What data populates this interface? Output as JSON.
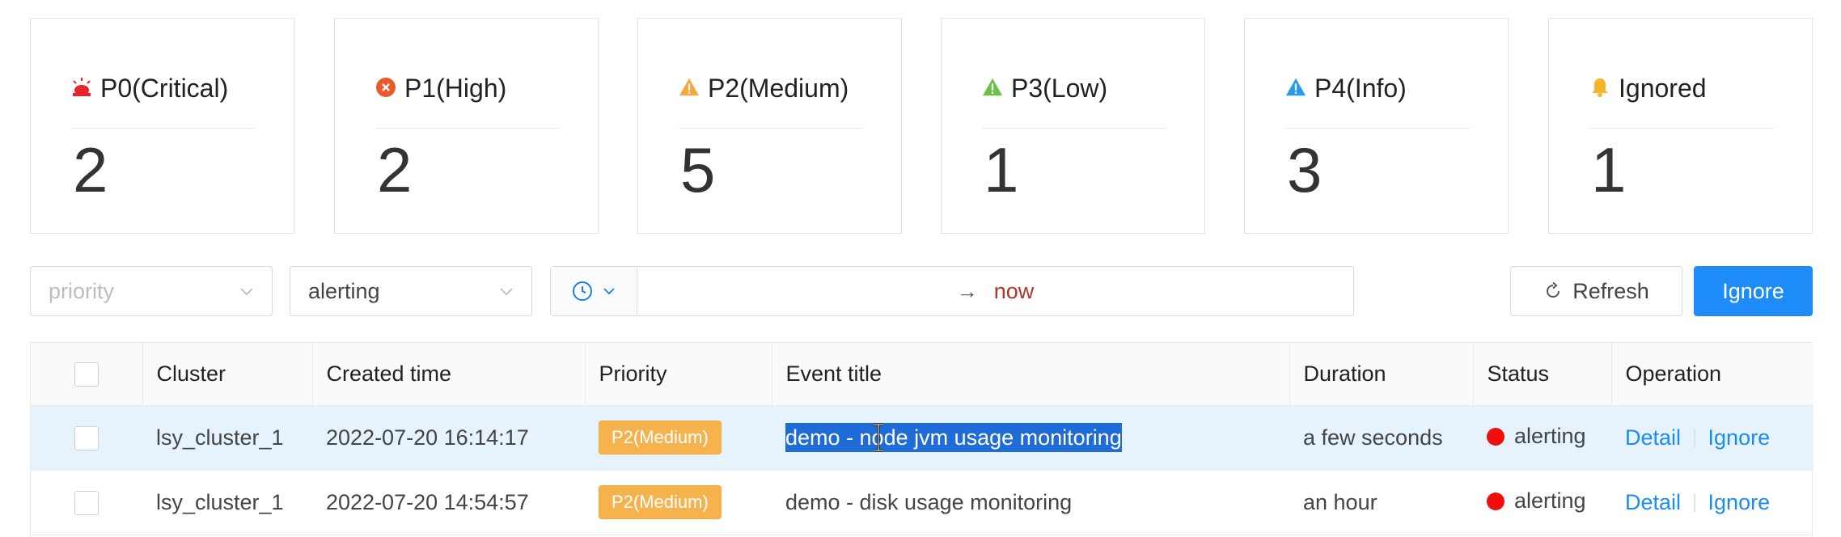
{
  "summary_cards": [
    {
      "label": "P0(Critical)",
      "count": "2",
      "icon": "siren-icon",
      "color": "#e8242b"
    },
    {
      "label": "P1(High)",
      "count": "2",
      "icon": "error-circle-icon",
      "color": "#ec5a2b"
    },
    {
      "label": "P2(Medium)",
      "count": "5",
      "icon": "warning-triangle-icon",
      "color": "#f5a742"
    },
    {
      "label": "P3(Low)",
      "count": "1",
      "icon": "warning-triangle-icon",
      "color": "#6fbf4b"
    },
    {
      "label": "P4(Info)",
      "count": "3",
      "icon": "warning-triangle-icon",
      "color": "#2a9be8"
    },
    {
      "label": "Ignored",
      "count": "1",
      "icon": "bell-icon",
      "color": "#f5b52a"
    }
  ],
  "filters": {
    "priority_placeholder": "priority",
    "status_value": "alerting",
    "time_end": "now"
  },
  "buttons": {
    "refresh": "Refresh",
    "ignore": "Ignore"
  },
  "table": {
    "headers": [
      "Cluster",
      "Created time",
      "Priority",
      "Event title",
      "Duration",
      "Status",
      "Operation"
    ],
    "rows": [
      {
        "cluster": "lsy_cluster_1",
        "created": "2022-07-20 16:14:17",
        "priority": "P2(Medium)",
        "title": "demo - node jvm usage monitoring",
        "duration": "a few seconds",
        "status": "alerting",
        "op_detail": "Detail",
        "op_ignore": "Ignore"
      },
      {
        "cluster": "lsy_cluster_1",
        "created": "2022-07-20 14:54:57",
        "priority": "P2(Medium)",
        "title": "demo - disk usage monitoring",
        "duration": "an hour",
        "status": "alerting",
        "op_detail": "Detail",
        "op_ignore": "Ignore"
      }
    ]
  },
  "colors": {
    "primary": "#1d8cf8",
    "link": "#1a8cf2",
    "tag": "#f5b24d",
    "status_dot": "#f40d0d",
    "selected_row": "#e6f3fd",
    "now_text": "#b0352f"
  }
}
